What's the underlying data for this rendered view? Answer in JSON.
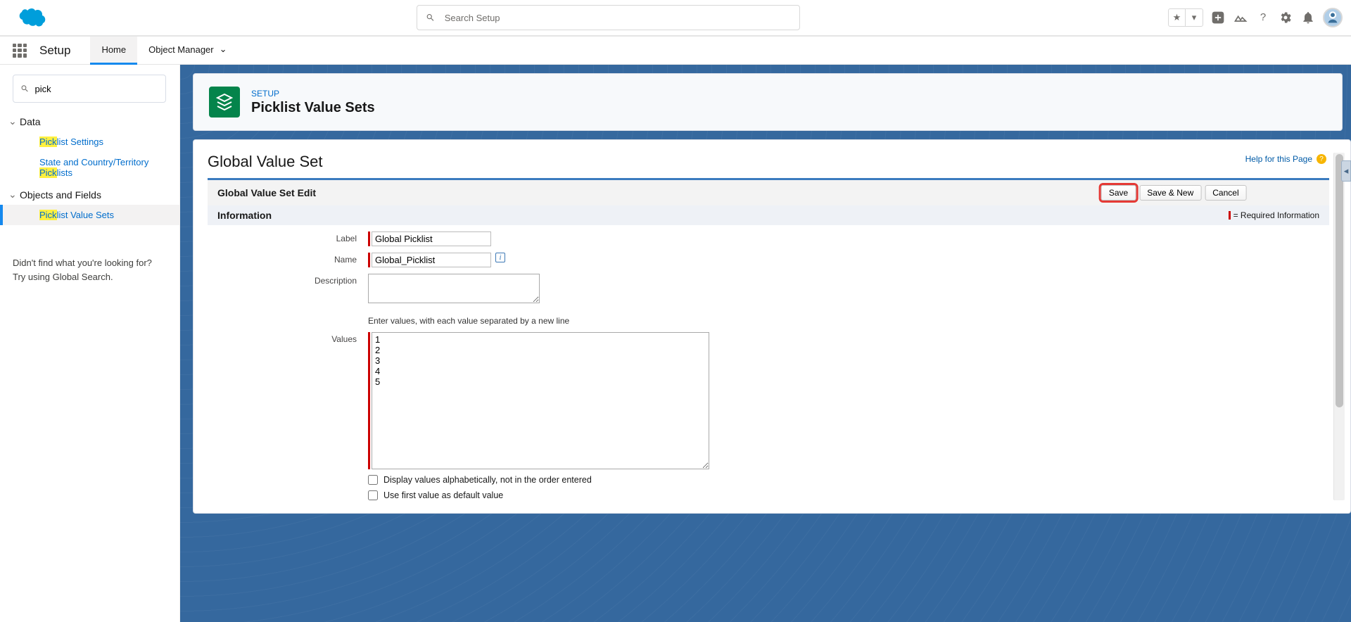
{
  "header": {
    "search_placeholder": "Search Setup"
  },
  "app": {
    "name": "Setup",
    "tabs": [
      {
        "label": "Home",
        "active": true,
        "has_menu": false
      },
      {
        "label": "Object Manager",
        "active": false,
        "has_menu": true
      }
    ]
  },
  "sidebar": {
    "quickfind": "pick",
    "groups": [
      {
        "label": "Data",
        "expanded": true,
        "items": [
          {
            "hl": "Pick",
            "rest": "list Settings",
            "active": false
          },
          {
            "hl": "",
            "rest_pre": "State and Country/Territory ",
            "hl2": "Pick",
            "rest2": "lists",
            "active": false
          }
        ]
      },
      {
        "label": "Objects and Fields",
        "expanded": true,
        "items": [
          {
            "hl": "Pick",
            "rest": "list Value Sets",
            "active": true
          }
        ]
      }
    ],
    "notfound1": "Didn't find what you're looking for?",
    "notfound2": "Try using Global Search."
  },
  "page": {
    "kicker": "SETUP",
    "title": "Picklist Value Sets",
    "detail_title": "Global Value Set",
    "help": "Help for this Page",
    "section": "Global Value Set Edit",
    "buttons": {
      "save": "Save",
      "save_new": "Save & New",
      "cancel": "Cancel"
    },
    "info_header": "Information",
    "required_info": "= Required Information",
    "form": {
      "label_lbl": "Label",
      "label_val": "Global Picklist",
      "name_lbl": "Name",
      "name_val": "Global_Picklist",
      "desc_lbl": "Description",
      "desc_val": "",
      "values_hint": "Enter values, with each value separated by a new line",
      "values_lbl": "Values",
      "values_val": "1\n2\n3\n4\n5",
      "check1": "Display values alphabetically, not in the order entered",
      "check2": "Use first value as default value"
    }
  }
}
